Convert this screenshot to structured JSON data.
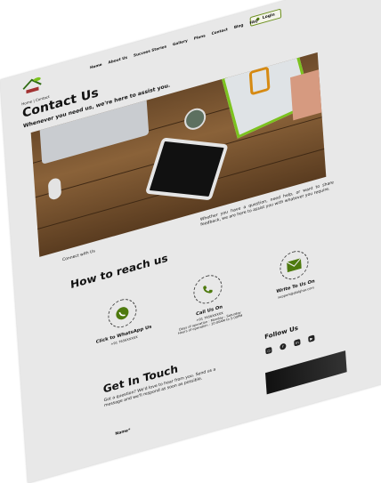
{
  "header": {
    "nav": [
      "Home",
      "About Us",
      "Success Stories",
      "Gallery",
      "Plans",
      "Contact",
      "Blog",
      "FAQ"
    ],
    "login_label": "Login"
  },
  "breadcrumb": "Home | Contact",
  "title": "Contact Us",
  "subtitle": "Whenever you need us, we're here to assist you.",
  "connect_label": "Connect with Us",
  "intro": "Whether you have a question, need help, or want to share feedback, we are here to assist you with whatever you require.",
  "reach": {
    "heading": "How to reach us",
    "whatsapp": {
      "label": "Click to WhatsApp Us",
      "detail": "+91 7656XXXXX"
    },
    "call": {
      "label": "Call Us On",
      "detail": "+91 7656XXXXX",
      "hours1": "Days of operation : Monday - Saturday",
      "hours2": "Hours of operation : 10:00AM to 5:00PM"
    },
    "mail": {
      "label": "Write To Us On",
      "detail": "support@dialghar.com"
    }
  },
  "follow": {
    "heading": "Follow Us",
    "icons": [
      "instagram-icon",
      "facebook-icon",
      "linkedin-icon",
      "youtube-icon"
    ]
  },
  "touch": {
    "heading": "Get In Touch",
    "text": "Got a question? We'd love to hear from you. Send us a message and we'll respond as soon as possible.",
    "name_label": "Name*"
  },
  "colors": {
    "accent": "#4e7a0e",
    "page_bg": "#e8e8e8"
  }
}
